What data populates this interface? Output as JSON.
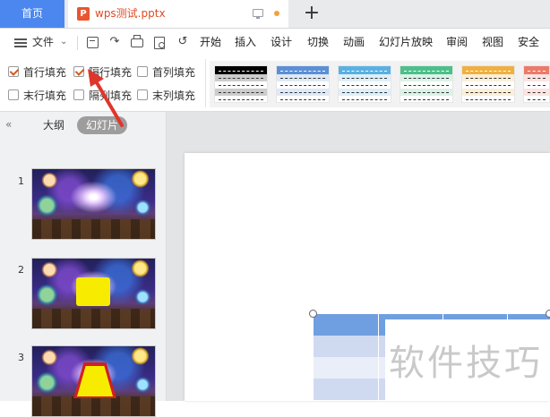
{
  "tabs": {
    "home_label": "首页",
    "doc_title": "wps测试.pptx",
    "doc_icon_letter": "P",
    "new_tab_symbol": "+"
  },
  "menu": {
    "file_label": "文件",
    "items": [
      "开始",
      "插入",
      "设计",
      "切换",
      "动画",
      "幻灯片放映",
      "审阅",
      "视图",
      "安全"
    ]
  },
  "ribbon": {
    "options": [
      {
        "label": "首行填充",
        "checked": true
      },
      {
        "label": "隔行填充",
        "checked": true
      },
      {
        "label": "首列填充",
        "checked": false
      },
      {
        "label": "末行填充",
        "checked": false
      },
      {
        "label": "隔列填充",
        "checked": false
      },
      {
        "label": "末列填充",
        "checked": false
      }
    ],
    "style_colors": [
      "#000000",
      "#5b8fd6",
      "#5ab0e2",
      "#4dbf8a",
      "#f0b040",
      "#ec7a6a"
    ]
  },
  "panel": {
    "outline_tab": "大纲",
    "slides_tab": "幻灯片",
    "slide_numbers": [
      "1",
      "2",
      "3"
    ]
  },
  "canvas": {
    "watermark": "软件技巧",
    "table_header_color": "#6f9fe0",
    "table_row_colors": [
      "#cfdaf1",
      "#e9eef8"
    ]
  },
  "colors": {
    "accent_blue": "#4b87ee",
    "doc_title_orange": "#e04a22",
    "check_orange": "#d35a1e",
    "annotation_red": "#e0352b"
  }
}
